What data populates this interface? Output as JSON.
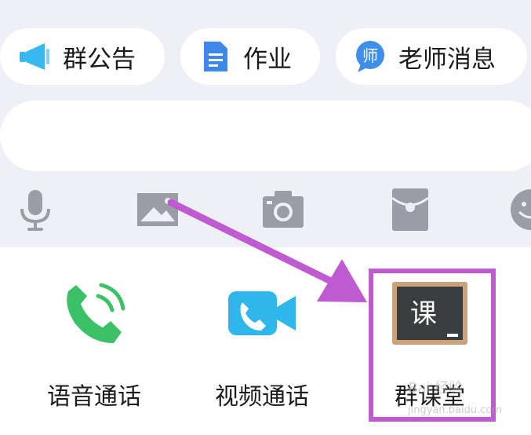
{
  "chips": [
    {
      "label": "群公告",
      "icon": "megaphone-icon"
    },
    {
      "label": "作业",
      "icon": "document-icon"
    },
    {
      "label": "老师消息",
      "icon": "teacher-message-icon",
      "badge_char": "师"
    }
  ],
  "input": {
    "placeholder": ""
  },
  "toolbar": [
    {
      "icon": "microphone-icon"
    },
    {
      "icon": "image-icon"
    },
    {
      "icon": "camera-icon"
    },
    {
      "icon": "red-packet-icon"
    },
    {
      "icon": "emoji-icon"
    }
  ],
  "apps": [
    {
      "label": "语音通话",
      "icon": "phone-call-icon"
    },
    {
      "label": "视频通话",
      "icon": "video-call-icon"
    },
    {
      "label": "群课堂",
      "icon": "blackboard-icon",
      "board_char": "课"
    }
  ],
  "watermark": {
    "text": "Bai 经验",
    "sub": "jingyan.baidu.com"
  },
  "colors": {
    "highlight": "#c05ad0",
    "toolbar_icon": "#9a9ca6",
    "phone_green": "#3cc168",
    "video_blue": "#2fb6ea"
  }
}
